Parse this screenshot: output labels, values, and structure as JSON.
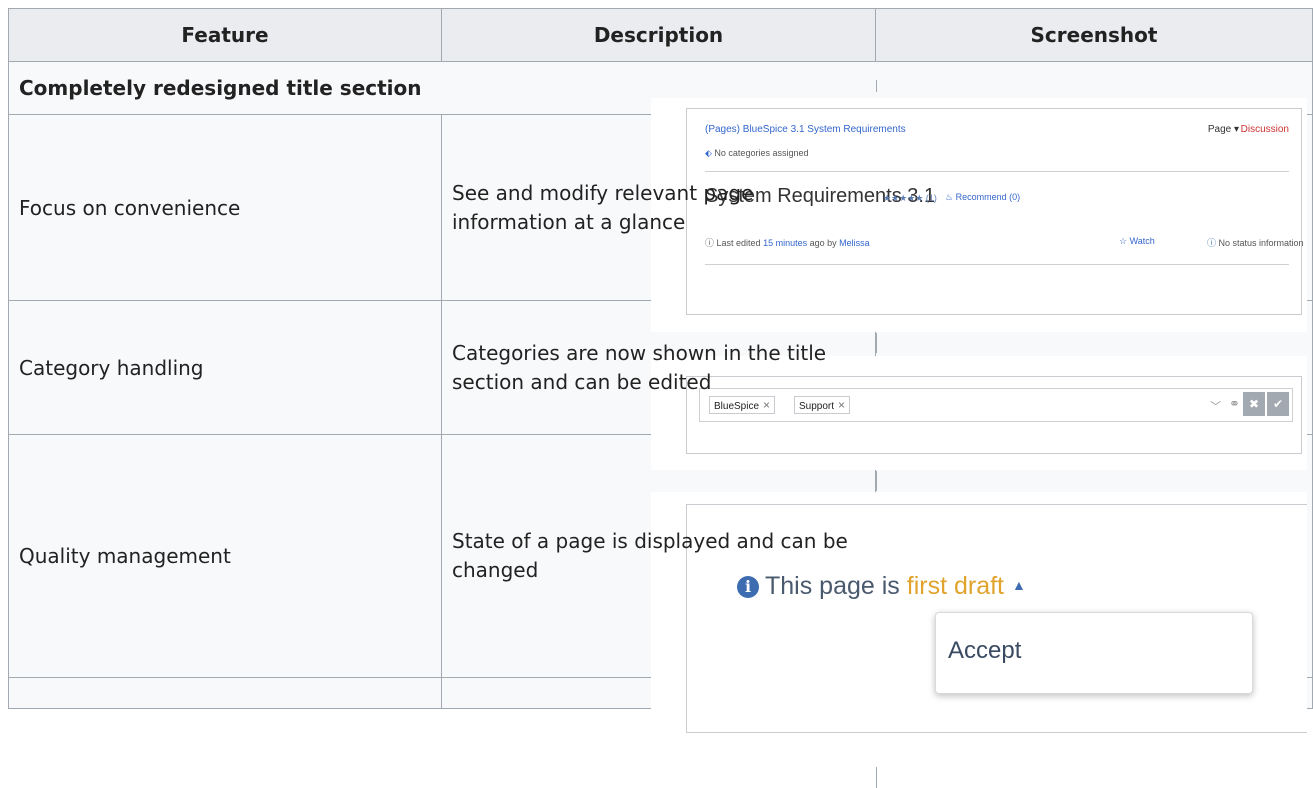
{
  "table": {
    "headers": [
      "Feature",
      "Description",
      "Screenshot"
    ],
    "section_title": "Completely redesigned title section",
    "rows": [
      {
        "feature": "Focus on convenience",
        "description": "See and modify relevant page information at a glance"
      },
      {
        "feature": "Category handling",
        "description": "Categories are now shown in the title section and can be edited"
      },
      {
        "feature": "Quality management",
        "description": "State of a page is displayed and can be changed"
      }
    ]
  },
  "screenshot1": {
    "breadcrumb": "(Pages)  BlueSpice 3.1 System Requirements",
    "page_menu": "Page ▾",
    "discussion": "Discussion",
    "categories": "No categories assigned",
    "title": "System Requirements 3.1",
    "rating": "★★★★★ (1)",
    "recommend": "Recommend (0)",
    "last_edited_prefix": "Last edited",
    "last_edited_time": "15 minutes",
    "last_edited_mid": "ago by",
    "last_edited_user": "Melissa",
    "watch": "Watch",
    "status": "No status information"
  },
  "screenshot2": {
    "tags": [
      "BlueSpice",
      "Support"
    ]
  },
  "screenshot3": {
    "status_prefix": "This page is",
    "status_value": "first draft",
    "menu_item": "Accept"
  },
  "colors": {
    "header_bg": "#eaecf0",
    "cell_bg": "#f8f9fa",
    "border": "#a2a9b1",
    "link": "#3366cc",
    "draft": "#e0a32c"
  }
}
